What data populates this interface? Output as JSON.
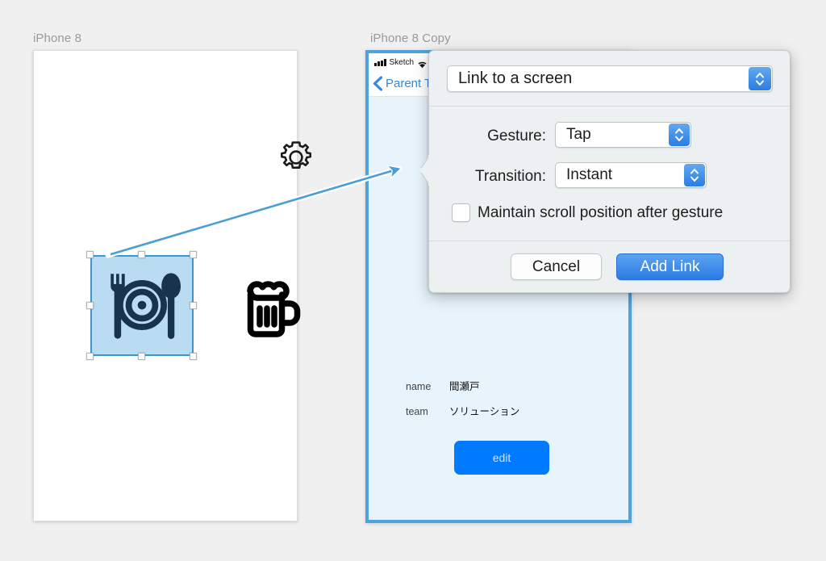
{
  "canvas": {
    "background": "#f0f0f0"
  },
  "artboards": [
    {
      "label": "iPhone 8",
      "icons": {
        "gear": "gear-icon",
        "restaurant": "restaurant-icon",
        "beer": "beer-mug-icon"
      }
    },
    {
      "label": "iPhone 8 Copy",
      "statusbar": {
        "carrier": "Sketch",
        "signal_icon": "signal-bars-icon",
        "wifi_icon": "wifi-icon"
      },
      "navbar": {
        "back_icon": "back-chevron-icon",
        "back_title": "Parent T"
      },
      "fields": [
        {
          "label": "name",
          "value": "間瀬戸"
        },
        {
          "label": "team",
          "value": "ソリューション"
        }
      ],
      "edit_button": "edit"
    }
  ],
  "link_arrow": {
    "color": "#4a9ed4",
    "name": "prototype-link-arrow"
  },
  "selection": {
    "fill": "#b9dcf2",
    "stroke": "#3d96d2",
    "handle_count": 8
  },
  "dialog": {
    "screen_select": {
      "value": "Link to a screen",
      "stepper_icon": "stepper-up-down-icon"
    },
    "gesture": {
      "label": "Gesture:",
      "value": "Tap",
      "stepper_icon": "stepper-up-down-icon"
    },
    "transition": {
      "label": "Transition:",
      "value": "Instant",
      "stepper_icon": "stepper-up-down-icon"
    },
    "maintain_scroll": {
      "label": "Maintain scroll position after gesture",
      "checked": false
    },
    "cancel_label": "Cancel",
    "add_link_label": "Add Link",
    "accent_color": "#2b7ae4"
  }
}
